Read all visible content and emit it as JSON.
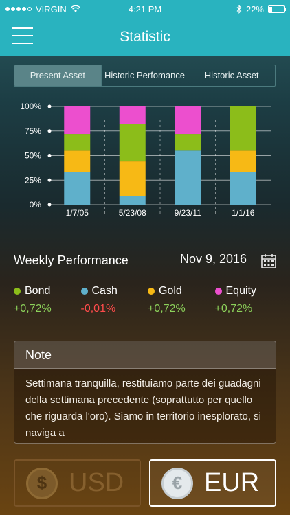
{
  "status": {
    "carrier": "VIRGIN",
    "time": "4:21 PM",
    "battery": "22%"
  },
  "nav": {
    "title": "Statistic"
  },
  "tabs": [
    {
      "label": "Present Asset",
      "active": true
    },
    {
      "label": "Historic Perfomance",
      "active": false
    },
    {
      "label": "Historic Asset",
      "active": false
    }
  ],
  "chart_data": {
    "type": "bar",
    "stacked": true,
    "categories": [
      "1/7/05",
      "5/23/08",
      "9/23/11",
      "1/1/16"
    ],
    "y_ticks": [
      "0%",
      "25%",
      "50%",
      "75%",
      "100%"
    ],
    "ylim": [
      0,
      100
    ],
    "series": [
      {
        "name": "Cash",
        "color": "#5fb0cb",
        "values": [
          33,
          9,
          55,
          33
        ]
      },
      {
        "name": "Gold",
        "color": "#f7b915",
        "values": [
          22,
          35,
          0,
          22
        ]
      },
      {
        "name": "Bond",
        "color": "#8cbd1a",
        "values": [
          17,
          38,
          17,
          45
        ]
      },
      {
        "name": "Equity",
        "color": "#ec4fce",
        "values": [
          28,
          18,
          28,
          0
        ]
      }
    ]
  },
  "weekly": {
    "title": "Weekly Performance",
    "date": "Nov 9, 2016",
    "items": [
      {
        "name": "Bond",
        "color": "#8cbd1a",
        "value": "+0,72%",
        "value_color": "#8cd15a"
      },
      {
        "name": "Cash",
        "color": "#5fb0cb",
        "value": "-0,01%",
        "value_color": "#ff4b4b"
      },
      {
        "name": "Gold",
        "color": "#f7b915",
        "value": "+0,72%",
        "value_color": "#8cd15a"
      },
      {
        "name": "Equity",
        "color": "#ec4fce",
        "value": "+0,72%",
        "value_color": "#8cd15a"
      }
    ]
  },
  "note": {
    "title": "Note",
    "text": "Settimana tranquilla, restituiamo parte dei guadagni della settimana precedente (soprattutto per quello che riguarda l'oro). Siamo in territorio inesplorato, si naviga a"
  },
  "currency": {
    "usd_label": "USD",
    "eur_label": "EUR",
    "usd_symbol": "$",
    "eur_symbol": "€"
  }
}
